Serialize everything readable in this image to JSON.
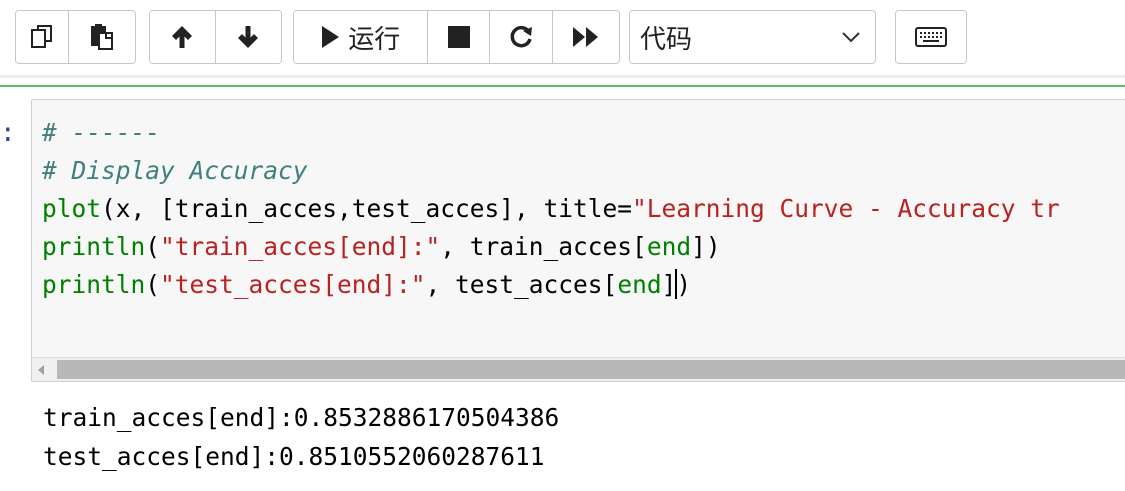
{
  "toolbar": {
    "copy_icon": "copy-icon",
    "paste_icon": "paste-icon",
    "move_up_icon": "arrow-up-icon",
    "move_down_icon": "arrow-down-icon",
    "run_icon": "play-icon",
    "run_label": "运行",
    "stop_icon": "stop-square-icon",
    "restart_icon": "restart-icon",
    "run_all_icon": "fast-forward-icon",
    "cell_type": {
      "selected": "代码",
      "chevron_icon": "chevron-down-icon"
    },
    "keyboard_icon": "keyboard-icon"
  },
  "cell": {
    "prompt": ":",
    "code_lines": [
      {
        "tokens": [
          {
            "t": "# ------",
            "c": "comment"
          }
        ]
      },
      {
        "tokens": [
          {
            "t": "# Display Accuracy",
            "c": "comment"
          }
        ]
      },
      {
        "tokens": [
          {
            "t": "plot",
            "c": "kw-fn"
          },
          {
            "t": "(x, [train_acces,test_acces], title=",
            "c": "plain"
          },
          {
            "t": "\"Learning Curve - Accuracy tr",
            "c": "str"
          }
        ]
      },
      {
        "tokens": [
          {
            "t": "println",
            "c": "kw-fn"
          },
          {
            "t": "(",
            "c": "plain"
          },
          {
            "t": "\"train_acces[end]:\"",
            "c": "str"
          },
          {
            "t": ", train_acces[",
            "c": "plain"
          },
          {
            "t": "end",
            "c": "kw-end"
          },
          {
            "t": "])",
            "c": "plain"
          }
        ]
      },
      {
        "tokens": [
          {
            "t": "println",
            "c": "kw-fn"
          },
          {
            "t": "(",
            "c": "plain"
          },
          {
            "t": "\"test_acces[end]:\"",
            "c": "str"
          },
          {
            "t": ", test_acces[",
            "c": "plain"
          },
          {
            "t": "end",
            "c": "kw-end"
          },
          {
            "t": "]",
            "c": "plain"
          },
          {
            "t": "",
            "c": "cursor"
          },
          {
            "t": ")",
            "c": "plain"
          }
        ]
      }
    ]
  },
  "output": {
    "lines": [
      "train_acces[end]:0.8532886170504386",
      "test_acces[end]:0.8510552060287611"
    ]
  },
  "colors": {
    "cell_selected_border": "#66bb6a",
    "comment": "#408080",
    "builtin": "#008000",
    "string": "#ba2121",
    "prompt": "#303f9f"
  }
}
